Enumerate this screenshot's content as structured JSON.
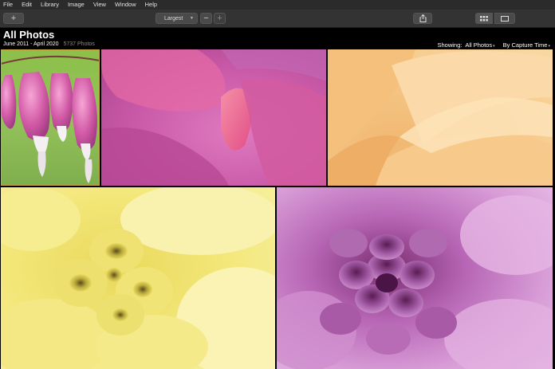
{
  "menu": [
    "File",
    "Edit",
    "Library",
    "Image",
    "View",
    "Window",
    "Help"
  ],
  "toolbar": {
    "add_label": "+",
    "size_selected": "Largest",
    "zoom_out_label": "−",
    "zoom_in_label": "+"
  },
  "header": {
    "title": "All Photos",
    "date_range": "June 2011 - April 2020",
    "photo_count": "5737 Photos",
    "showing_label": "Showing:",
    "showing_value": "All Photos",
    "sort_value": "By Capture Time"
  },
  "photos": [
    {
      "subject": "pink bleeding heart flowers",
      "selected": true
    },
    {
      "subject": "pink petal macro"
    },
    {
      "subject": "orange dahlia petals"
    },
    {
      "subject": "yellow dahlia"
    },
    {
      "subject": "purple dahlia"
    }
  ],
  "colors": {
    "selection_outline": "#c9a640",
    "toolbar_bg": "#333333",
    "menubar_bg": "#2b2b2b"
  }
}
